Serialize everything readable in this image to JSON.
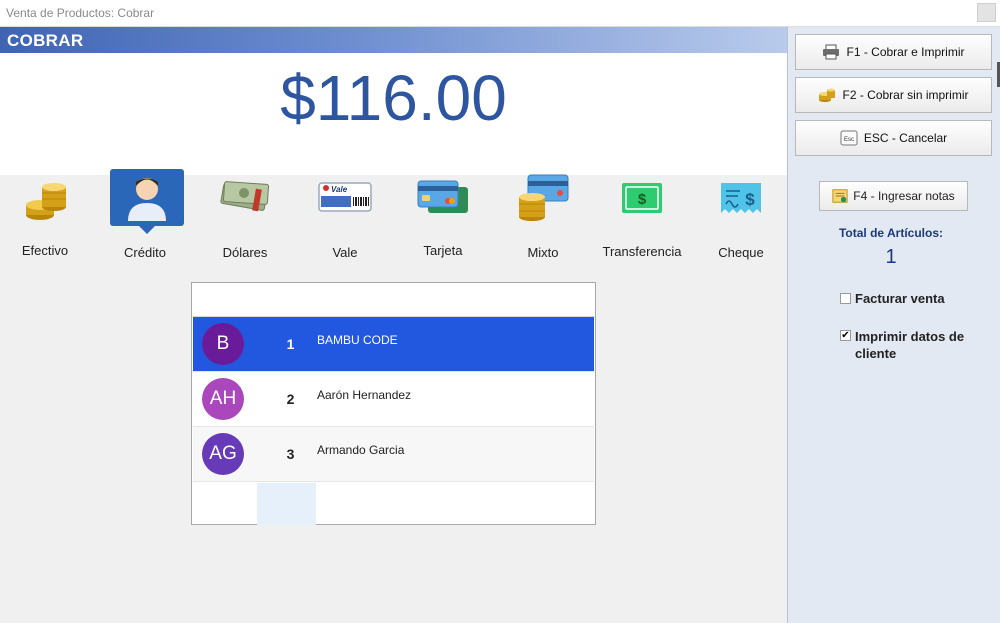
{
  "window": {
    "title": "Venta de Productos: Cobrar"
  },
  "header": {
    "title": "COBRAR"
  },
  "amount": "$116.00",
  "payment_methods": [
    {
      "label": "Efectivo",
      "icon": "coins-icon",
      "selected": false
    },
    {
      "label": "Crédito",
      "icon": "person-icon",
      "selected": true
    },
    {
      "label": "Dólares",
      "icon": "dollar-bills-icon",
      "selected": false
    },
    {
      "label": "Vale",
      "icon": "voucher-icon",
      "icon_text": "Vale",
      "selected": false
    },
    {
      "label": "Tarjeta",
      "icon": "credit-card-icon",
      "selected": false
    },
    {
      "label": "Mixto",
      "icon": "mixed-payment-icon",
      "selected": false
    },
    {
      "label": "Transferencia",
      "icon": "transfer-icon",
      "icon_text": "$",
      "selected": false
    },
    {
      "label": "Cheque",
      "icon": "check-icon",
      "icon_text": "$",
      "selected": false
    }
  ],
  "clients": {
    "search_value": "",
    "rows": [
      {
        "initials": "B",
        "number": "1",
        "name": "BAMBU CODE",
        "avatar_color": "#6a1b9a",
        "selected": true
      },
      {
        "initials": "AH",
        "number": "2",
        "name": "Aarón Hernandez",
        "avatar_color": "#ab47bc",
        "selected": false
      },
      {
        "initials": "AG",
        "number": "3",
        "name": "Armando Garcia",
        "avatar_color": "#673ab7",
        "selected": false
      }
    ]
  },
  "side": {
    "buttons": [
      {
        "label": "F1 - Cobrar e Imprimir",
        "icon": "printer-icon"
      },
      {
        "label": "F2 - Cobrar sin imprimir",
        "icon": "coins-icon"
      },
      {
        "label": "ESC - Cancelar",
        "icon": "esc-key-icon",
        "icon_text": "Esc"
      }
    ],
    "notes_button": {
      "label": "F4 - Ingresar notas",
      "icon": "notes-icon"
    },
    "total_label": "Total de Artículos:",
    "total_value": "1",
    "invoice": {
      "label": "Facturar venta",
      "checked": false
    },
    "print_client": {
      "label": "Imprimir datos de cliente",
      "checked": true,
      "mark": "✔"
    }
  },
  "colors": {
    "accent": "#2e56a0",
    "selected_row": "#2257e0",
    "selected_method": "#2a67b8"
  }
}
